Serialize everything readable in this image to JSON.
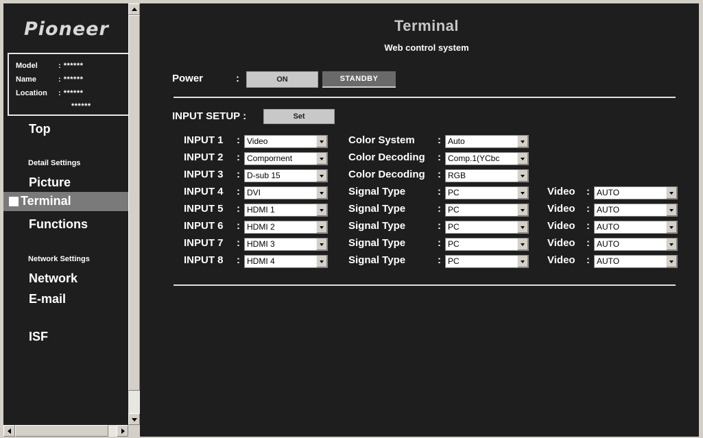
{
  "brand": "Pioneer",
  "info": {
    "model_label": "Model",
    "model_value": ": ******",
    "name_label": "Name",
    "name_value": ": ******",
    "location_label": "Location",
    "location_value": ": ******",
    "location_extra": "******"
  },
  "nav": {
    "top": "Top",
    "detail_settings": "Detail Settings",
    "picture": "Picture",
    "terminal": "Terminal",
    "functions": "Functions",
    "network_settings": "Network Settings",
    "network": "Network",
    "email": "E-mail",
    "isf": "ISF",
    "active": "Terminal"
  },
  "header": {
    "title": "Terminal",
    "subtitle": "Web control system"
  },
  "power": {
    "label": "Power",
    "colon": ":",
    "on": "ON",
    "standby": "STANDBY",
    "selected": "STANDBY"
  },
  "input_setup": {
    "label": "INPUT SETUP :",
    "set_button": "Set"
  },
  "inputs": [
    {
      "label": "INPUT 1",
      "source": "Video",
      "param_label": "Color System",
      "param_value": "Auto",
      "video_label": "",
      "video_value": ""
    },
    {
      "label": "INPUT 2",
      "source": "Compornent",
      "param_label": "Color Decoding",
      "param_value": "Comp.1(YCbc",
      "video_label": "",
      "video_value": ""
    },
    {
      "label": "INPUT 3",
      "source": "D-sub 15",
      "param_label": "Color Decoding",
      "param_value": "RGB",
      "video_label": "",
      "video_value": ""
    },
    {
      "label": "INPUT 4",
      "source": "DVI",
      "param_label": "Signal Type",
      "param_value": "PC",
      "video_label": "Video",
      "video_value": "AUTO"
    },
    {
      "label": "INPUT 5",
      "source": "HDMI 1",
      "param_label": "Signal Type",
      "param_value": "PC",
      "video_label": "Video",
      "video_value": "AUTO"
    },
    {
      "label": "INPUT 6",
      "source": "HDMI 2",
      "param_label": "Signal Type",
      "param_value": "PC",
      "video_label": "Video",
      "video_value": "AUTO"
    },
    {
      "label": "INPUT 7",
      "source": "HDMI 3",
      "param_label": "Signal Type",
      "param_value": "PC",
      "video_label": "Video",
      "video_value": "AUTO"
    },
    {
      "label": "INPUT 8",
      "source": "HDMI 4",
      "param_label": "Signal Type",
      "param_value": "PC",
      "video_label": "Video",
      "video_value": "AUTO"
    }
  ],
  "colors": {
    "background": "#1e1e1e",
    "active_nav": "#7a7a7a",
    "button_light": "#c8c8c8",
    "button_dark": "#6a6a6a"
  }
}
